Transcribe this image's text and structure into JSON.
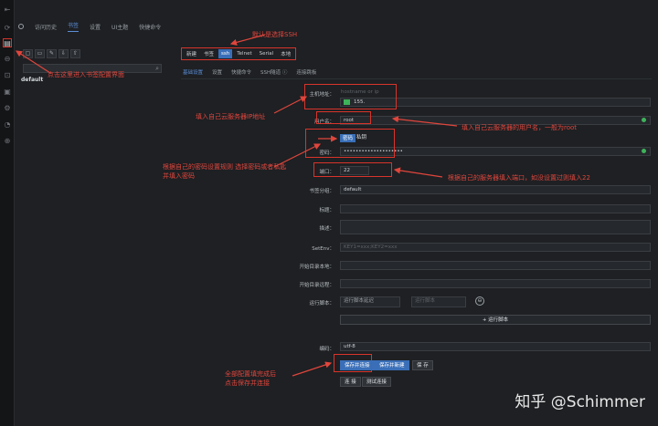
{
  "rail_icons": [
    "⇤",
    "⟳",
    "▤",
    "⊖",
    "⊡",
    "▣",
    "⚙",
    "◔",
    "⊕",
    "≡",
    "✦"
  ],
  "top_tabs": [
    "访问历史",
    "书签",
    "设置",
    "UI主题",
    "快捷命令"
  ],
  "tree": {
    "tools": [
      "▢",
      "▭",
      "✎",
      "⇩",
      "⇧"
    ],
    "search_icon": "⌕",
    "root_node": "default"
  },
  "type_bar": [
    "新建",
    "书签",
    "ssh",
    "Telnet",
    "Serial",
    "本地"
  ],
  "sub_tabs": [
    "基础设置",
    "设置",
    "快捷命令",
    "SSH隧道 ⓘ",
    "连接跳板"
  ],
  "form": {
    "host_label": "主机地址：",
    "host_placeholder": "hostname or ip",
    "host_value": "155.",
    "user_label": "用户名：",
    "user_value": "root",
    "auth_tabs": [
      "密码",
      "私钥"
    ],
    "password_label": "密码：",
    "password_value": "••••••••••••••••••••",
    "port_label": "端口：",
    "port_value": "22",
    "parent_label": "书签分组：",
    "parent_value": "default",
    "title_label": "标题：",
    "desc_label": "描述：",
    "setenv_label": "SetEnv：",
    "setenv_placeholder": "KEY1=xxx;KEY2=xxx",
    "start_local_label": "开始目录本地：",
    "start_remote_label": "开始目录远程：",
    "run_script_label": "运行脚本：",
    "run_script_delay": "运行脚本延迟",
    "run_script_cmd": "运行脚本",
    "add_script_button": "+ 运行脚本",
    "encode_label": "编码：",
    "encode_value": "utf-8",
    "save_connect_button": "保存并连接",
    "save_new_button": "保存并新建",
    "save_button": "保 存",
    "test_button": "连 接",
    "test_conn_button": "测试连接"
  },
  "annotations": {
    "default_ssh": "默认是选择SSH",
    "click_bookmark": "点击这里进入书签配置界面",
    "fill_ip": "填入自己云服务器IP地址",
    "fill_user": "填入自己云服务器的用户名，一般为root",
    "choose_auth_1": "根据自己的密码设置规则 选择密码或者私匙",
    "choose_auth_2": "并填入密码",
    "fill_port": "根据自己的服务器填入端口，如没设置过则填入22",
    "save_1": "全部配置填完成后",
    "save_2": "点击保存并连接"
  },
  "watermark": "知乎 @Schimmer",
  "colors": {
    "annotation": "#e0453c",
    "accent": "#3a6fb8",
    "background": "#1e2023"
  }
}
